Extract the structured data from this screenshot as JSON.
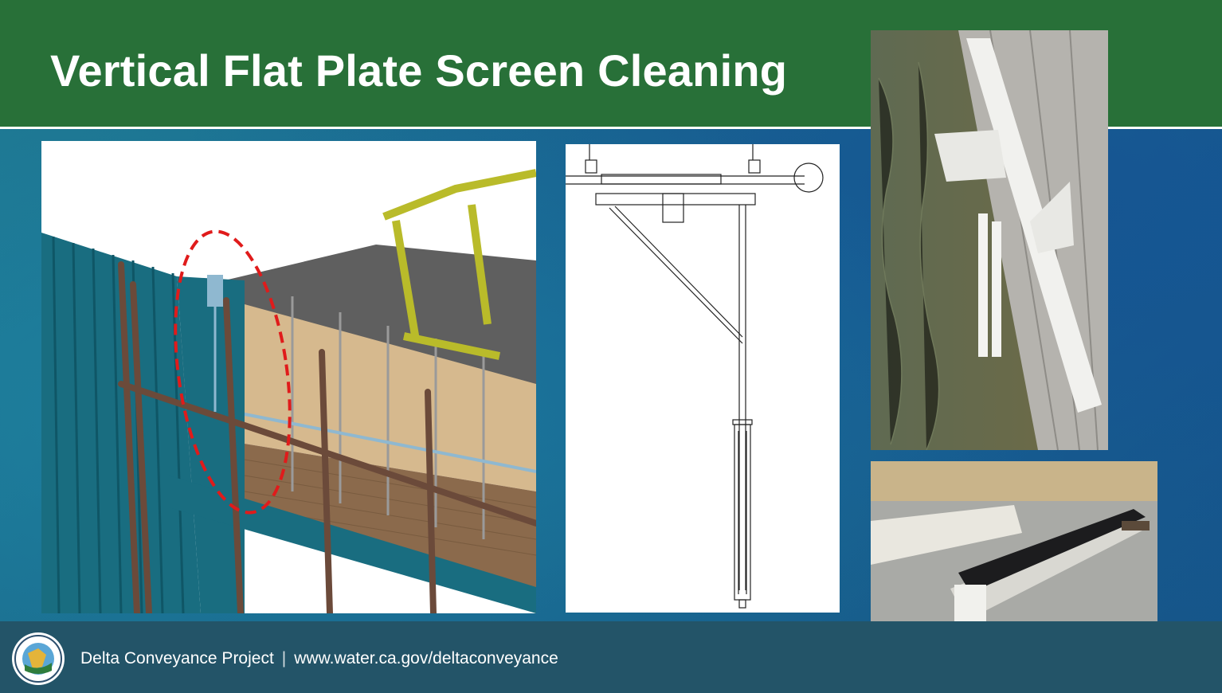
{
  "slide": {
    "title": "Vertical Flat Plate Screen Cleaning"
  },
  "footer": {
    "project_name": "Delta Conveyance Project",
    "separator": "|",
    "url": "www.water.ca.gov/deltaconveyance",
    "seal_icon": "dwr-seal-icon"
  },
  "images": {
    "render_icon": "screen-cleaner-3d-render-image",
    "drawing_icon": "screen-cleaner-line-drawing-image",
    "photo_installed_icon": "installed-cleaner-photo-image",
    "photo_brush_icon": "cleaning-brush-photo-image"
  },
  "colors": {
    "header_green": "#287038",
    "footer_teal": "#235468",
    "highlight_red": "#e01b1b"
  }
}
